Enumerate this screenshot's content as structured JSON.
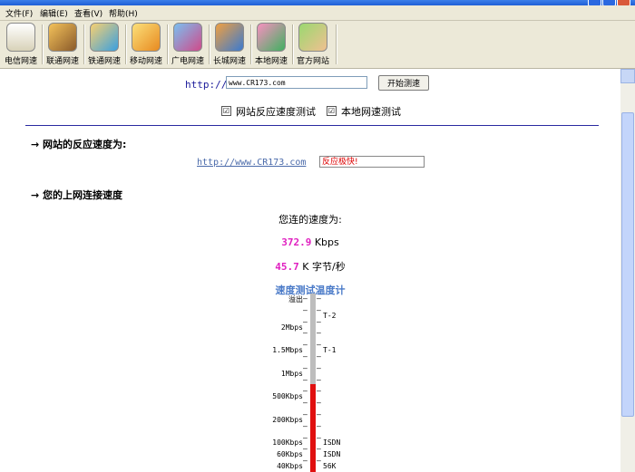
{
  "menu": [
    "文件(F)",
    "编辑(E)",
    "查看(V)",
    "帮助(H)"
  ],
  "toolbar": [
    {
      "label": "电信网速",
      "icon": "scale-icon"
    },
    {
      "label": "联通网速",
      "icon": "fox-icon"
    },
    {
      "label": "铁通网速",
      "icon": "cartoon-icon"
    },
    {
      "label": "移动网速",
      "icon": "box-icon"
    },
    {
      "label": "广电网速",
      "icon": "monitor-icon"
    },
    {
      "label": "长城网速",
      "icon": "wall-icon"
    },
    {
      "label": "本地网速",
      "icon": "girl-icon"
    },
    {
      "label": "官方网站",
      "icon": "boy-icon"
    }
  ],
  "url": {
    "label": "http://",
    "value": "www.CR173.com"
  },
  "start_button": "开始测速",
  "options": [
    {
      "checked_glyph": "☑",
      "label": "网站反应速度测试"
    },
    {
      "checked_glyph": "☑",
      "label": "本地网速测试"
    }
  ],
  "sections": {
    "reaction": "→  网站的反应速度为:",
    "speed": "→  您的上网连接速度"
  },
  "result": {
    "link": "http://www.CR173.com",
    "status": "反应极快!"
  },
  "speed": {
    "intro": "您连的速度为:",
    "kbps_value": "372.9",
    "kbps_unit": "Kbps",
    "kbyte_value": "45.7",
    "kbyte_unit": "K 字节/秒"
  },
  "thermometer": {
    "title": "速度测试温度计",
    "left_labels": [
      "溢出",
      "2Mbps",
      "1.5Mbps",
      "1Mbps",
      "500Kbps",
      "200Kbps",
      "100Kbps",
      "60Kbps",
      "40Kbps"
    ],
    "right_labels": [
      "T-2",
      "T-1",
      "ISDN",
      "ISDN",
      "56K"
    ],
    "fill_percent": 0.41,
    "bar_color": "#e01010"
  }
}
